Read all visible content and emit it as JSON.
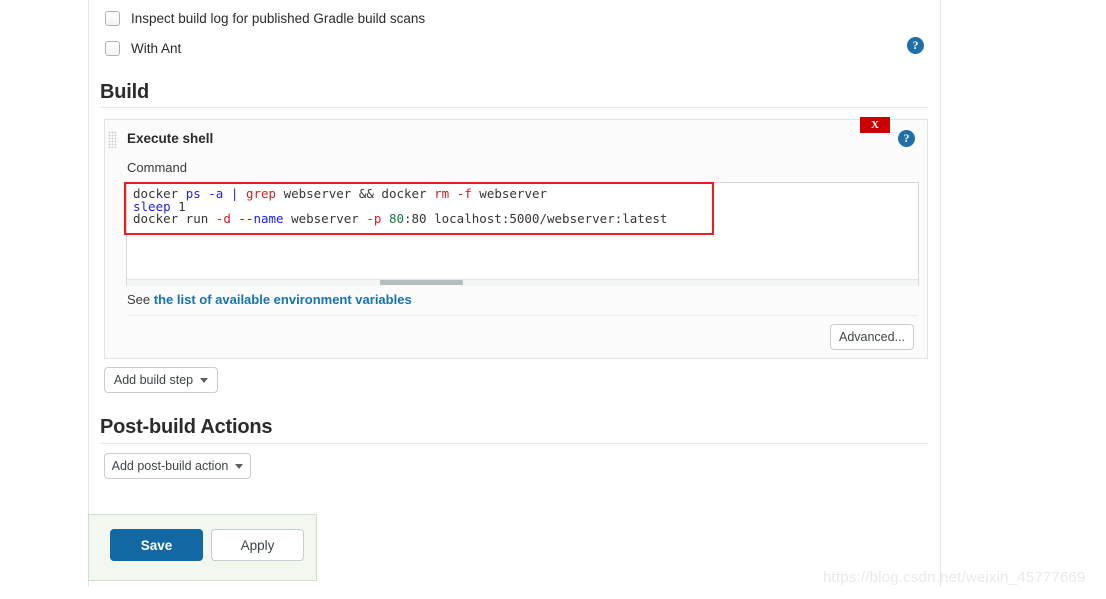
{
  "page": {
    "watermark": "https://blog.csdn.net/weixin_45777669"
  },
  "options": {
    "checkboxes": [
      {
        "label": "Inspect build log for published Gradle build scans",
        "checked": false
      },
      {
        "label": "With Ant",
        "checked": false
      }
    ],
    "help_icon": "help-icon",
    "help_glyph": "?"
  },
  "build_section": {
    "heading": "Build",
    "step": {
      "title": "Execute shell",
      "drag_handle_icon": "drag-handle-icon",
      "delete_label": "X",
      "help_glyph": "?",
      "command_label": "Command",
      "command_value": "docker ps -a | grep webserver && docker rm -f webserver\nsleep 1\ndocker run -d --name webserver -p 80:80 localhost:5000/webserver:latest",
      "command_tokens": [
        [
          {
            "t": "docker ",
            "c": "plain"
          },
          {
            "t": "ps",
            "c": "blue"
          },
          {
            "t": " ",
            "c": "plain"
          },
          {
            "t": "-a",
            "c": "blue"
          },
          {
            "t": " ",
            "c": "plain"
          },
          {
            "t": "|",
            "c": "blue"
          },
          {
            "t": " ",
            "c": "plain"
          },
          {
            "t": "grep",
            "c": "red"
          },
          {
            "t": " webserver ",
            "c": "plain"
          },
          {
            "t": "&&",
            "c": "plain"
          },
          {
            "t": " docker ",
            "c": "plain"
          },
          {
            "t": "rm",
            "c": "red"
          },
          {
            "t": " ",
            "c": "plain"
          },
          {
            "t": "-f",
            "c": "red"
          },
          {
            "t": " webserver",
            "c": "plain"
          }
        ],
        [
          {
            "t": "sleep",
            "c": "blue"
          },
          {
            "t": " 1",
            "c": "plain"
          }
        ],
        [
          {
            "t": "docker run ",
            "c": "plain"
          },
          {
            "t": "-d",
            "c": "red"
          },
          {
            "t": " ",
            "c": "plain"
          },
          {
            "t": "--name",
            "c": "blue"
          },
          {
            "t": " webserver ",
            "c": "plain"
          },
          {
            "t": "-p",
            "c": "red"
          },
          {
            "t": " ",
            "c": "plain"
          },
          {
            "t": "80",
            "c": "green"
          },
          {
            "t": ":80 localhost:5000/webserver:latest",
            "c": "plain"
          }
        ]
      ],
      "env_prefix": "See ",
      "env_link": "the list of available environment variables",
      "advanced_label": "Advanced..."
    },
    "add_build_step_label": "Add build step"
  },
  "post_build_section": {
    "heading": "Post-build Actions",
    "add_post_build_label": "Add post-build action"
  },
  "save_bar": {
    "save_label": "Save",
    "apply_label": "Apply"
  }
}
